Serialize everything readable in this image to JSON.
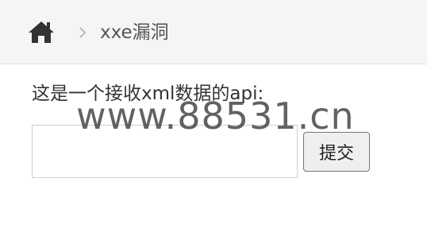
{
  "breadcrumb": {
    "home_icon": "home-icon",
    "separator_icon": "chevron-right-icon",
    "current": "xxe漏洞"
  },
  "main": {
    "description": "这是一个接收xml数据的api:",
    "xml_input": {
      "value": "",
      "placeholder": ""
    },
    "submit_label": "提交"
  },
  "watermark": "www.88531.cn",
  "colors": {
    "breadcrumb_bg": "#f5f5f5",
    "text": "#333333",
    "separator": "#bbbbbb"
  }
}
